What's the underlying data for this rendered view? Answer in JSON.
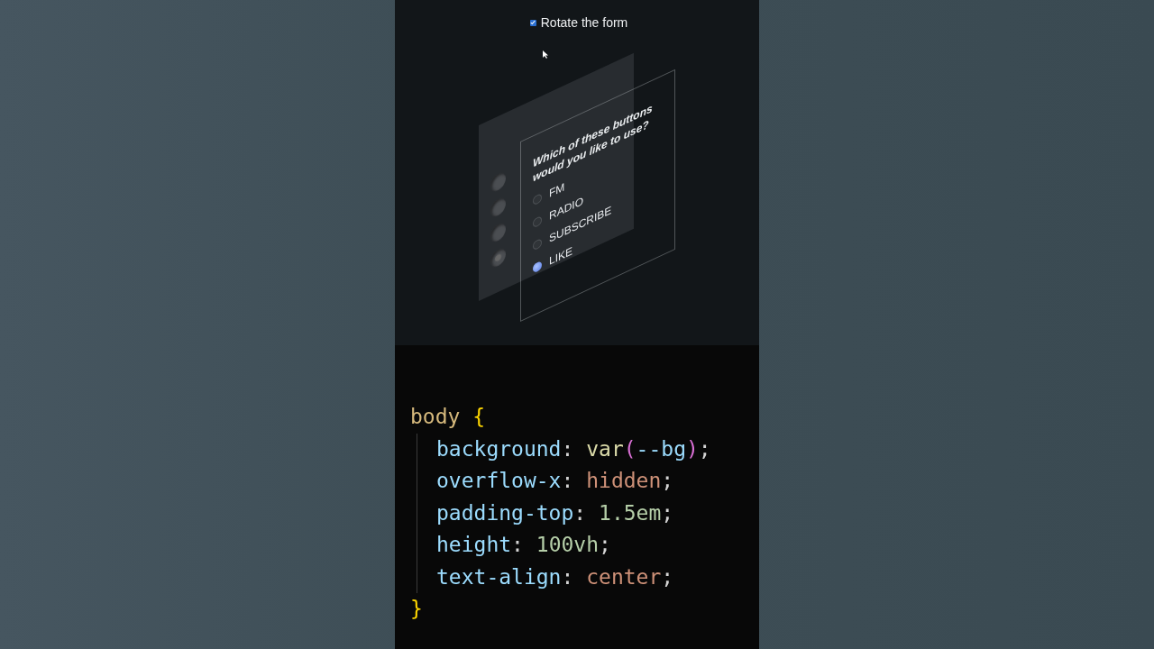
{
  "demo": {
    "checkbox": {
      "label": "Rotate the form",
      "checked": true
    },
    "form": {
      "question": "Which of these buttons would you like to use?",
      "options": [
        {
          "label": "FM",
          "selected": false
        },
        {
          "label": "RADIO",
          "selected": false
        },
        {
          "label": "SUBSCRIBE",
          "selected": false
        },
        {
          "label": "LIKE",
          "selected": true
        }
      ]
    }
  },
  "code": {
    "opening": [
      {
        "text": "body",
        "kind": "selector"
      },
      {
        "text": "{",
        "kind": "brace"
      }
    ],
    "declarations": [
      [
        {
          "text": "background",
          "kind": "property"
        },
        {
          "text": ": ",
          "kind": "punct"
        },
        {
          "text": "var",
          "kind": "function"
        },
        {
          "text": "(",
          "kind": "paren"
        },
        {
          "text": "--bg",
          "kind": "variable"
        },
        {
          "text": ")",
          "kind": "paren"
        },
        {
          "text": ";",
          "kind": "punct"
        }
      ],
      [
        {
          "text": "overflow-x",
          "kind": "property"
        },
        {
          "text": ": ",
          "kind": "punct"
        },
        {
          "text": "hidden",
          "kind": "keyword"
        },
        {
          "text": ";",
          "kind": "punct"
        }
      ],
      [
        {
          "text": "padding-top",
          "kind": "property"
        },
        {
          "text": ": ",
          "kind": "punct"
        },
        {
          "text": "1.5em",
          "kind": "number"
        },
        {
          "text": ";",
          "kind": "punct"
        }
      ],
      [
        {
          "text": "height",
          "kind": "property"
        },
        {
          "text": ": ",
          "kind": "punct"
        },
        {
          "text": "100vh",
          "kind": "number"
        },
        {
          "text": ";",
          "kind": "punct"
        }
      ],
      [
        {
          "text": "text-align",
          "kind": "property"
        },
        {
          "text": ": ",
          "kind": "punct"
        },
        {
          "text": "center",
          "kind": "keyword"
        },
        {
          "text": ";",
          "kind": "punct"
        }
      ]
    ],
    "closing": [
      {
        "text": "}",
        "kind": "brace"
      }
    ]
  }
}
